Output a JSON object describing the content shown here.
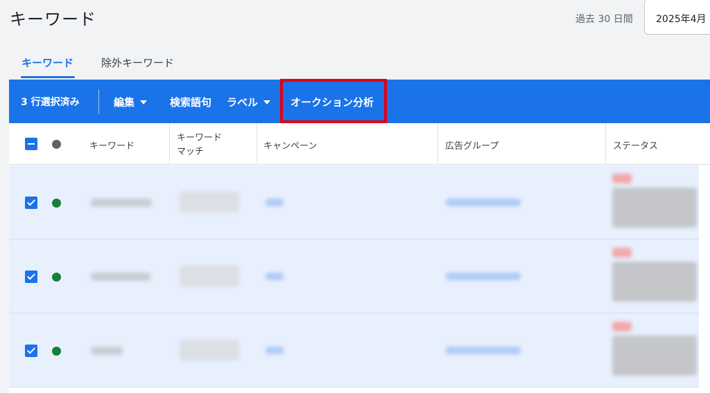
{
  "header": {
    "title": "キーワード",
    "date_range_label": "過去 30 日間",
    "date_value": "2025年4月"
  },
  "tabs": [
    {
      "label": "キーワード",
      "active": true
    },
    {
      "label": "除外キーワード",
      "active": false
    }
  ],
  "action_bar": {
    "selected_count": "3 行選択済み",
    "edit": "編集",
    "search_terms": "検索語句",
    "label": "ラベル",
    "auction_insights": "オークション分析"
  },
  "table": {
    "columns": [
      "キーワード",
      "キーワード\nマッチ",
      "キャンペーン",
      "広告グループ",
      "ステータス"
    ],
    "match_col_lines": [
      "キーワード",
      "マッチ"
    ],
    "rows": [
      {
        "selected": true,
        "status": "enabled"
      },
      {
        "selected": true,
        "status": "enabled"
      },
      {
        "selected": true,
        "status": "enabled"
      }
    ]
  },
  "colors": {
    "primary": "#1a73e8",
    "highlight": "#e3000f",
    "enabled_dot": "#188038",
    "row_selected_bg": "#e8f0fe"
  }
}
